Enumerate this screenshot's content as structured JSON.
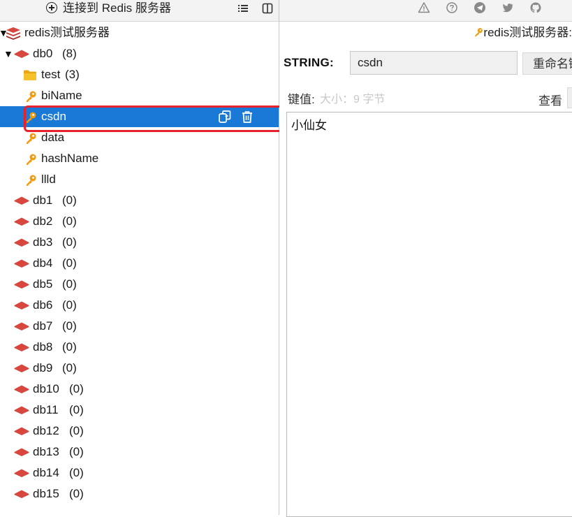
{
  "left_toolbar": {
    "connect_label": "连接到 Redis 服务器"
  },
  "tree": {
    "server": {
      "name": "redis测试服务器"
    },
    "db0": {
      "name": "db0",
      "count": "(8)"
    },
    "folder": {
      "name": "test",
      "count": "(3)"
    },
    "keys": [
      "biName",
      "csdn",
      "data",
      "hashName",
      "llld"
    ],
    "selected_key": "csdn",
    "databases": [
      {
        "name": "db1",
        "count": "(0)"
      },
      {
        "name": "db2",
        "count": "(0)"
      },
      {
        "name": "db3",
        "count": "(0)"
      },
      {
        "name": "db4",
        "count": "(0)"
      },
      {
        "name": "db5",
        "count": "(0)"
      },
      {
        "name": "db6",
        "count": "(0)"
      },
      {
        "name": "db7",
        "count": "(0)"
      },
      {
        "name": "db8",
        "count": "(0)"
      },
      {
        "name": "db9",
        "count": "(0)"
      },
      {
        "name": "db10",
        "count": "(0)"
      },
      {
        "name": "db11",
        "count": "(0)"
      },
      {
        "name": "db12",
        "count": "(0)"
      },
      {
        "name": "db13",
        "count": "(0)"
      },
      {
        "name": "db14",
        "count": "(0)"
      },
      {
        "name": "db15",
        "count": "(0)"
      }
    ]
  },
  "right": {
    "tab_title": "redis测试服务器:",
    "type_label": "STRING:",
    "key_name": "csdn",
    "rename_label": "重命名键",
    "value_label": "键值:",
    "value_meta": "大小：9 字节",
    "view_label": "查看",
    "value": "小仙女"
  },
  "colors": {
    "selection": "#1a78d6",
    "highlight": "#e8222d",
    "db_icon": "#d9463e",
    "key_icon": "#f29b0c",
    "folder_icon": "#f6b91c"
  },
  "icons": {
    "toolbar_left": [
      "plus-circle-icon",
      "list-icon",
      "split-view-icon"
    ],
    "toolbar_right": [
      "warning-icon",
      "help-icon",
      "telegram-icon",
      "twitter-icon",
      "github-icon"
    ],
    "row_actions": [
      "copy-icon",
      "trash-icon"
    ]
  }
}
